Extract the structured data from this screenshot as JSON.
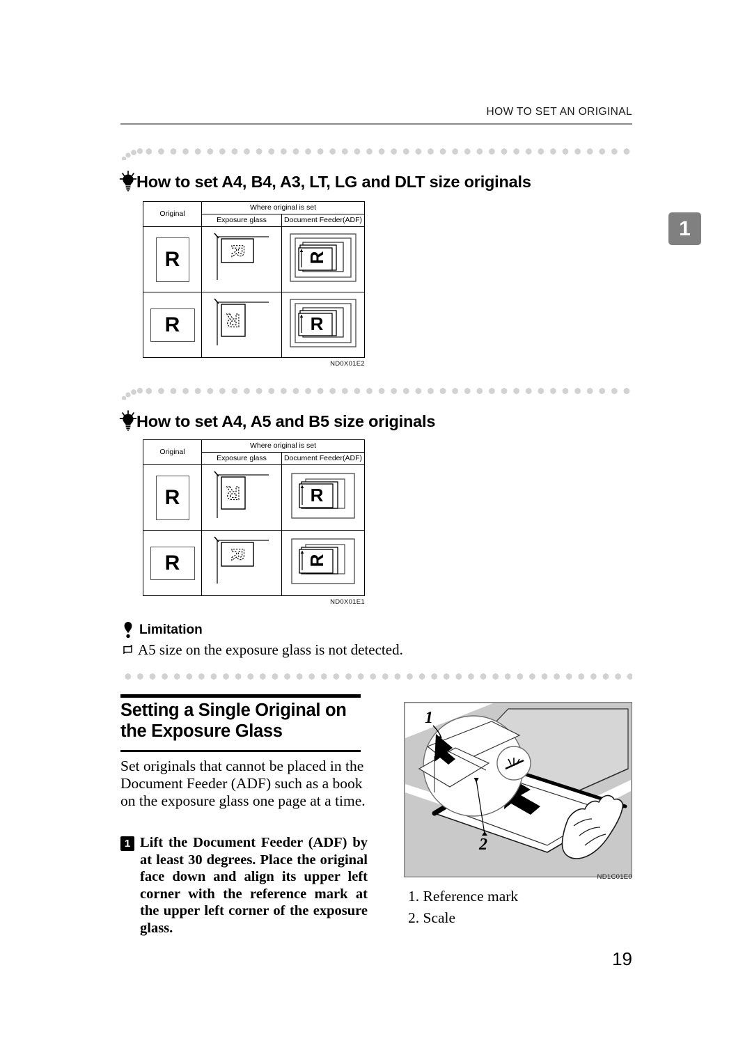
{
  "header": {
    "running_head": "HOW TO SET AN ORIGINAL",
    "chapter_tab": "1"
  },
  "tips": [
    {
      "icon": "lightbulb-icon",
      "title": "How to set A4, B4, A3, LT, LG and DLT size originals",
      "figure": {
        "code": "ND0X01E2",
        "headers": {
          "original": "Original",
          "group": "Where original is set",
          "exposure_glass": "Exposure glass",
          "document_feeder": "Document Feeder(ADF)"
        },
        "rows": [
          {
            "original_orientation": "portrait",
            "original_letter": "R",
            "exposure_glass_letter": "R",
            "exposure_glass_rotation": "90",
            "adf_letter": "R",
            "adf_rotation": "-90"
          },
          {
            "original_orientation": "landscape",
            "original_letter": "R",
            "exposure_glass_letter": "R",
            "exposure_glass_rotation": "180",
            "adf_letter": "R",
            "adf_rotation": "0"
          }
        ]
      }
    },
    {
      "icon": "lightbulb-icon",
      "title": "How to set A4, A5 and B5 size originals",
      "figure": {
        "code": "ND0X01E1",
        "headers": {
          "original": "Original",
          "group": "Where original is set",
          "exposure_glass": "Exposure glass",
          "document_feeder": "Document Feeder(ADF)"
        },
        "rows": [
          {
            "original_orientation": "portrait",
            "original_letter": "R",
            "exposure_glass_letter": "R",
            "exposure_glass_rotation": "180",
            "adf_letter": "R",
            "adf_rotation": "0"
          },
          {
            "original_orientation": "landscape",
            "original_letter": "R",
            "exposure_glass_letter": "R",
            "exposure_glass_rotation": "90",
            "adf_letter": "R",
            "adf_rotation": "-90"
          }
        ]
      }
    }
  ],
  "limitation": {
    "icon": "limitation-icon",
    "heading": "Limitation",
    "bullet_icon": "square-bullet-icon",
    "text": "A5 size on the exposure glass is not detected."
  },
  "section": {
    "title": "Setting a Single Original on the Exposure Glass",
    "intro": "Set originals that cannot be placed in the Document Feeder (ADF) such as a book on the exposure glass one page at a time.",
    "step": {
      "number": "1",
      "text": "Lift the Document Feeder (ADF) by at least 30 degrees. Place the original face down and align its upper left corner with the reference mark at the upper left corner of the exposure glass."
    }
  },
  "illustration": {
    "code": "ND1C01E0",
    "callout_1": "1",
    "callout_2": "2",
    "legend": [
      "1. Reference mark",
      "2. Scale"
    ]
  },
  "footer": {
    "page_number": "19"
  }
}
